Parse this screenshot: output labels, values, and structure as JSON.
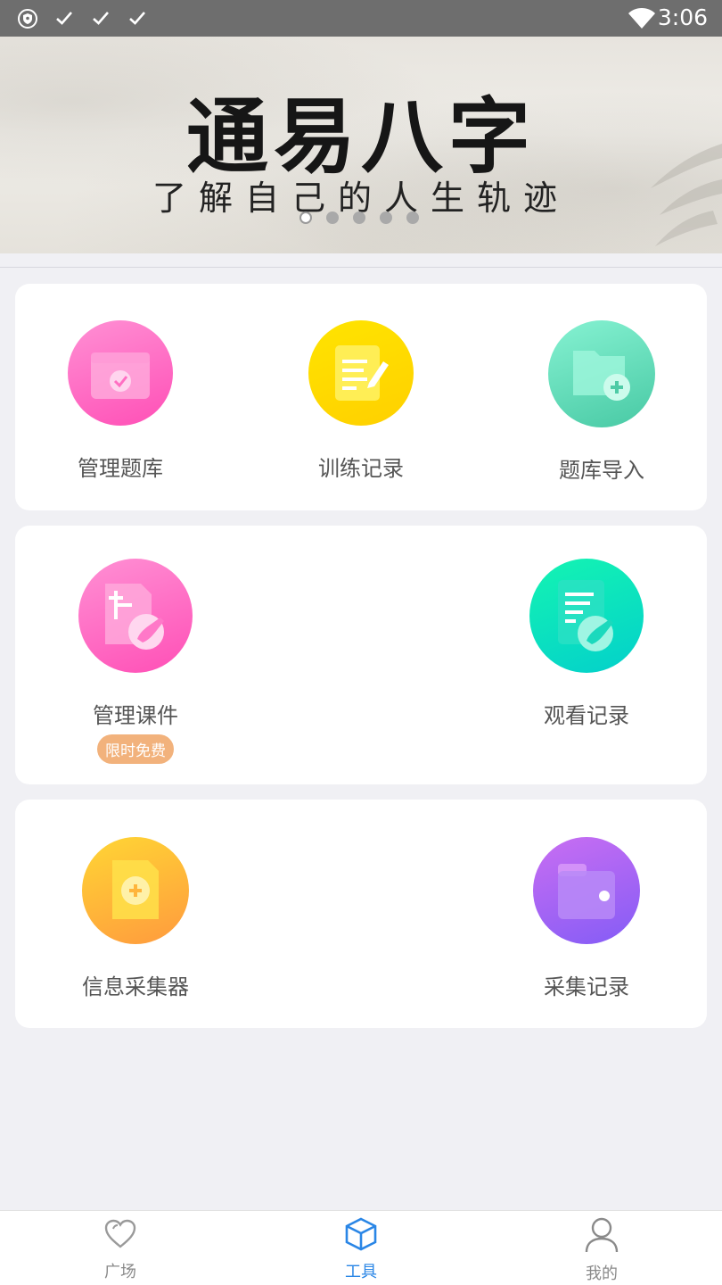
{
  "status_bar": {
    "time": "3:06",
    "left_icons": [
      "shield-icon",
      "check-icon",
      "check-icon",
      "check-icon"
    ],
    "right_icons": [
      "wifi-icon"
    ]
  },
  "banner": {
    "title": "通易八字",
    "subtitle": "了解自己的人生轨迹",
    "dots_count": 5,
    "active_dot": 0
  },
  "sections": [
    {
      "items": [
        {
          "label": "管理题库",
          "icon": "calendar-check-icon",
          "colors": [
            "#ff8ad0",
            "#ff4fb6"
          ]
        },
        {
          "label": "训练记录",
          "icon": "note-pen-icon",
          "colors": [
            "#ffe100",
            "#ffd200"
          ]
        },
        {
          "label": "题库导入",
          "icon": "folder-plus-icon",
          "colors": [
            "#7aefcb",
            "#4ecfa9"
          ]
        }
      ]
    },
    {
      "items": [
        {
          "label": "管理课件",
          "icon": "courseware-edit-icon",
          "badge": "限时免费",
          "colors": [
            "#ff8ad0",
            "#ff4fb6"
          ]
        },
        {
          "label": "观看记录",
          "icon": "document-edit-icon",
          "colors": [
            "#14f1b5",
            "#05d2c8"
          ]
        }
      ]
    },
    {
      "items": [
        {
          "label": "信息采集器",
          "icon": "file-plus-icon",
          "colors": [
            "#ffd23a",
            "#ff9b3d"
          ]
        },
        {
          "label": "采集记录",
          "icon": "wallet-folder-icon",
          "colors": [
            "#c466f0",
            "#8a5cf5"
          ]
        }
      ]
    }
  ],
  "bottom_nav": [
    {
      "label": "广场",
      "icon": "heart-icon",
      "active": false
    },
    {
      "label": "工具",
      "icon": "cube-icon",
      "active": true
    },
    {
      "label": "我的",
      "icon": "user-icon",
      "active": false
    }
  ],
  "colors": {
    "accent": "#2a86e6",
    "badge": "#f2b27c",
    "status_bar": "#6e6e6e",
    "page_bg": "#f0f0f4"
  }
}
